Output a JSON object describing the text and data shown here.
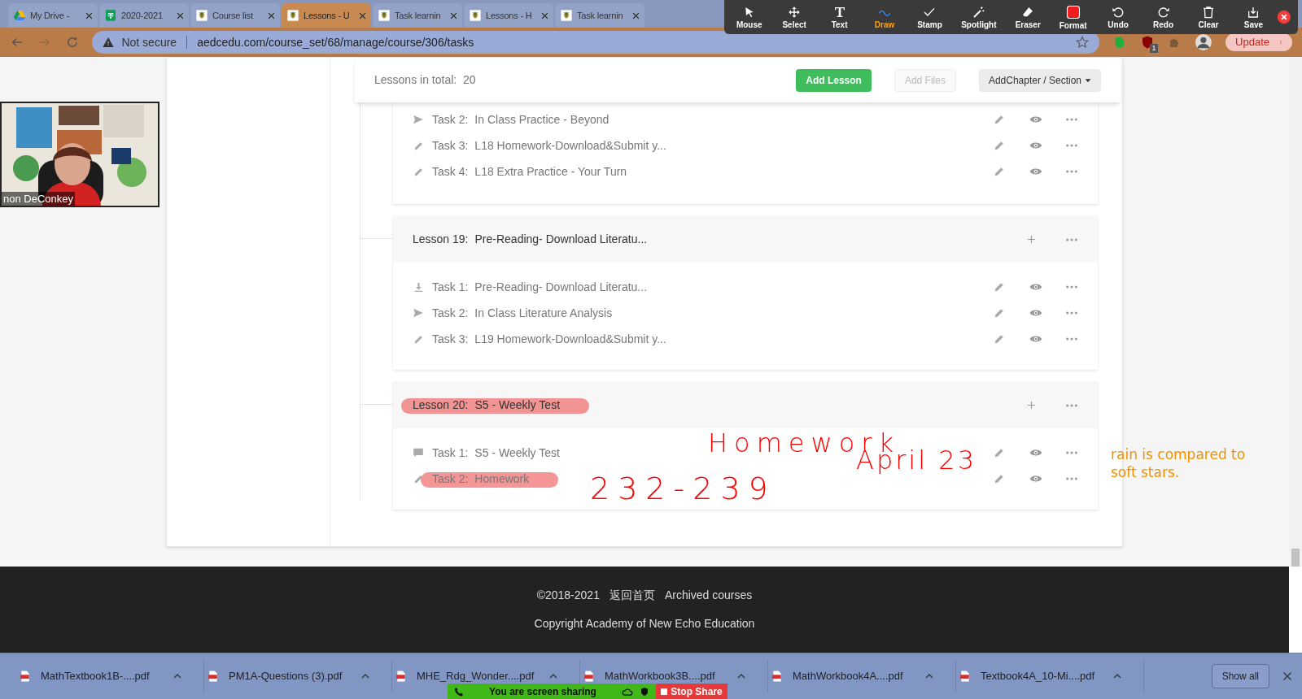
{
  "browser_tabs": [
    {
      "kind": "drive",
      "title": "My Drive -",
      "selected": false
    },
    {
      "kind": "sheets",
      "title": "2020-2021",
      "selected": false
    },
    {
      "kind": "school",
      "title": "Course list",
      "selected": false
    },
    {
      "kind": "school",
      "title": "Lessons - U",
      "selected": true
    },
    {
      "kind": "school",
      "title": "Task learnin",
      "selected": false
    },
    {
      "kind": "school",
      "title": "Lessons - H",
      "selected": false
    },
    {
      "kind": "school",
      "title": "Task learnin",
      "selected": false
    }
  ],
  "address_bar": {
    "security": "Not secure",
    "url": "aedcedu.com/course_set/68/manage/course/306/tasks"
  },
  "extensions": {
    "badge": "1",
    "update_button": "Update"
  },
  "annotation_toolbar": [
    {
      "kind": "mouse",
      "label": "Mouse",
      "selected": false
    },
    {
      "kind": "select",
      "label": "Select",
      "selected": false
    },
    {
      "kind": "text",
      "label": "Text",
      "selected": false
    },
    {
      "kind": "draw",
      "label": "Draw",
      "selected": true
    },
    {
      "kind": "stamp",
      "label": "Stamp",
      "selected": false
    },
    {
      "kind": "spotlight",
      "label": "Spotlight",
      "selected": false
    },
    {
      "kind": "eraser",
      "label": "Eraser",
      "selected": false
    },
    {
      "kind": "format",
      "label": "Format",
      "selected": false
    },
    {
      "kind": "undo",
      "label": "Undo",
      "selected": false
    },
    {
      "kind": "redo",
      "label": "Redo",
      "selected": false
    },
    {
      "kind": "clear",
      "label": "Clear",
      "selected": false
    },
    {
      "kind": "save",
      "label": "Save",
      "selected": false
    }
  ],
  "video_tile": {
    "name": "non DeConkey"
  },
  "lessons_header": {
    "total_label": "Lessons in total:",
    "total": "20",
    "add_lesson": "Add Lesson",
    "add_files": "Add Files",
    "add_chapter": "AddChapter / Section"
  },
  "lessons": [
    {
      "highlighted": false,
      "tasks": [
        {
          "kind": "send",
          "label": "Task 2:",
          "name": "In Class Practice - Beyond",
          "highlighted": false
        },
        {
          "kind": "pencil",
          "label": "Task 3:",
          "name": "L18 Homework-Download&Submit y...",
          "highlighted": false
        },
        {
          "kind": "pencil",
          "label": "Task 4:",
          "name": "L18 Extra Practice - Your Turn",
          "highlighted": false
        }
      ]
    },
    {
      "title": "Lesson 19:",
      "name": "Pre-Reading- Download Literatu...",
      "highlighted": false,
      "tasks": [
        {
          "kind": "download",
          "label": "Task 1:",
          "name": "Pre-Reading- Download Literatu...",
          "highlighted": false
        },
        {
          "kind": "send",
          "label": "Task 2:",
          "name": "In Class Literature Analysis",
          "highlighted": false
        },
        {
          "kind": "pencil",
          "label": "Task 3:",
          "name": "L19 Homework-Download&Submit y...",
          "highlighted": false
        }
      ]
    },
    {
      "title": "Lesson 20:",
      "name": "S5 - Weekly Test",
      "highlighted": true,
      "tasks": [
        {
          "kind": "comment",
          "label": "Task 1:",
          "name": "S5 - Weekly Test",
          "highlighted": false
        },
        {
          "kind": "pencil",
          "label": "Task 2:",
          "name": "Homework",
          "highlighted": true
        }
      ]
    }
  ],
  "handwriting": [
    "Homework",
    "April 23",
    "232-239"
  ],
  "side_note": "rain is compared to soft stars.",
  "footer": {
    "copyright_years": "©2018-2021",
    "home_link": "返回首页",
    "archived_link": "Archived courses",
    "copyright": "Copyright Academy of New Echo Education"
  },
  "downloads": [
    "MathTextbook1B-....pdf",
    "PM1A-Questions (3).pdf",
    "MHE_Rdg_Wonder....pdf",
    "MathWorkbook3B....pdf",
    "MathWorkbook4A....pdf",
    "Textbook4A_10-Mi....pdf"
  ],
  "show_all": "Show all",
  "share_banner": {
    "status": "You are screen sharing",
    "stop": "Stop Share"
  }
}
